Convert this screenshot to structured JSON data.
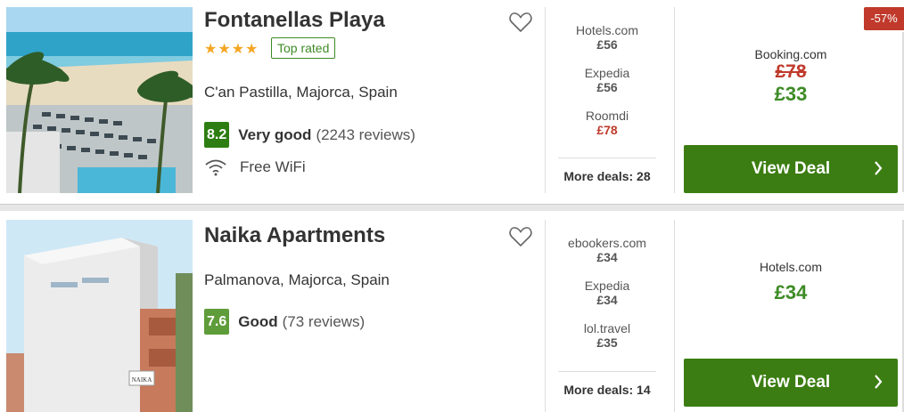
{
  "hotels": [
    {
      "name": "Fontanellas Playa",
      "stars": "★★★★",
      "badge": "Top rated",
      "location": "C'an Pastilla, Majorca, Spain",
      "score": "8.2",
      "rating_text": "Very good",
      "reviews": "(2243 reviews)",
      "amenity": "Free WiFi",
      "deals": [
        {
          "site": "Hotels.com",
          "price": "£56"
        },
        {
          "site": "Expedia",
          "price": "£56"
        },
        {
          "site": "Roomdi",
          "price": "£78"
        }
      ],
      "more_deals": "More deals: 28",
      "best_site": "Booking.com",
      "old_price": "£78",
      "best_price": "£33",
      "discount": "-57%",
      "view_label": "View Deal"
    },
    {
      "name": "Naika Apartments",
      "location": "Palmanova, Majorca, Spain",
      "score": "7.6",
      "rating_text": "Good",
      "reviews": "(73 reviews)",
      "deals": [
        {
          "site": "ebookers.com",
          "price": "£34"
        },
        {
          "site": "Expedia",
          "price": "£34"
        },
        {
          "site": "lol.travel",
          "price": "£35"
        }
      ],
      "more_deals": "More deals: 14",
      "best_site": "Hotels.com",
      "best_price": "£34",
      "view_label": "View Deal",
      "sign_text": "NAIKA"
    }
  ],
  "colors": {
    "accent_green": "#3b7d12",
    "price_red": "#c0392b",
    "star_orange": "#f5a623"
  }
}
